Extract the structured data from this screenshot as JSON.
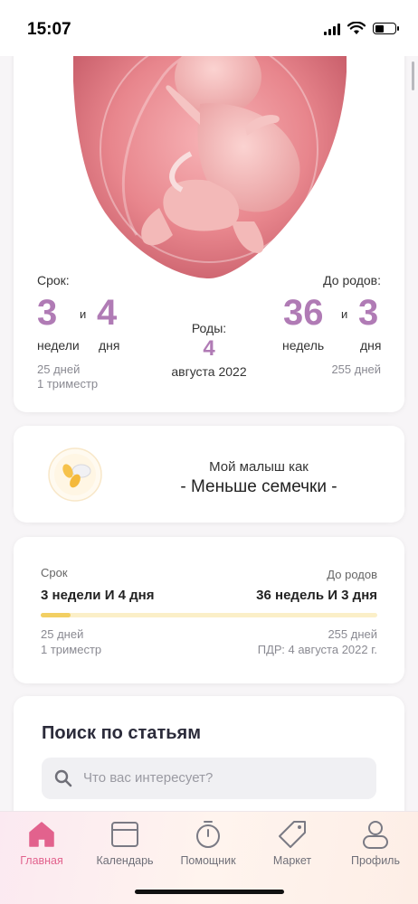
{
  "status_bar": {
    "time": "15:07"
  },
  "hero": {
    "term_label": "Срок:",
    "due_label": "До родов:",
    "term_weeks": "3",
    "term_and": "и",
    "term_days": "4",
    "term_weeks_unit": "недели",
    "term_days_unit": "дня",
    "term_total_days": "25 дней",
    "term_trimester": "1 триместр",
    "birth_label": "Роды:",
    "birth_day": "4",
    "birth_month_year": "августа 2022",
    "due_weeks": "36",
    "due_and": "и",
    "due_days": "3",
    "due_weeks_unit": "недель",
    "due_days_unit": "дня",
    "due_total_days": "255 дней"
  },
  "baby": {
    "title": "Мой малыш как",
    "size": "- Меньше семечки -",
    "icon": "seed-icon"
  },
  "progress_card": {
    "term_label": "Срок",
    "due_label": "До родов",
    "term_value": "3 недели И 4 дня",
    "due_value": "36 недель И 3 дня",
    "progress_fraction": 0.09,
    "days_passed": "25 дней",
    "trimester": "1 триместр",
    "days_left": "255 дней",
    "pdr": "ПДР: 4 августа 2022 г."
  },
  "search": {
    "title": "Поиск по статьям",
    "placeholder": "Что вас интересует?"
  },
  "tabs": [
    {
      "label": "Главная",
      "icon": "home-icon",
      "active": true
    },
    {
      "label": "Календарь",
      "icon": "calendar-icon",
      "active": false
    },
    {
      "label": "Помощник",
      "icon": "timer-icon",
      "active": false
    },
    {
      "label": "Маркет",
      "icon": "tag-icon",
      "active": false
    },
    {
      "label": "Профиль",
      "icon": "profile-icon",
      "active": false
    }
  ],
  "colors": {
    "accent_purple": "#b07bb5",
    "accent_pink": "#e2628d",
    "progress_yellow": "#f2cf63"
  }
}
